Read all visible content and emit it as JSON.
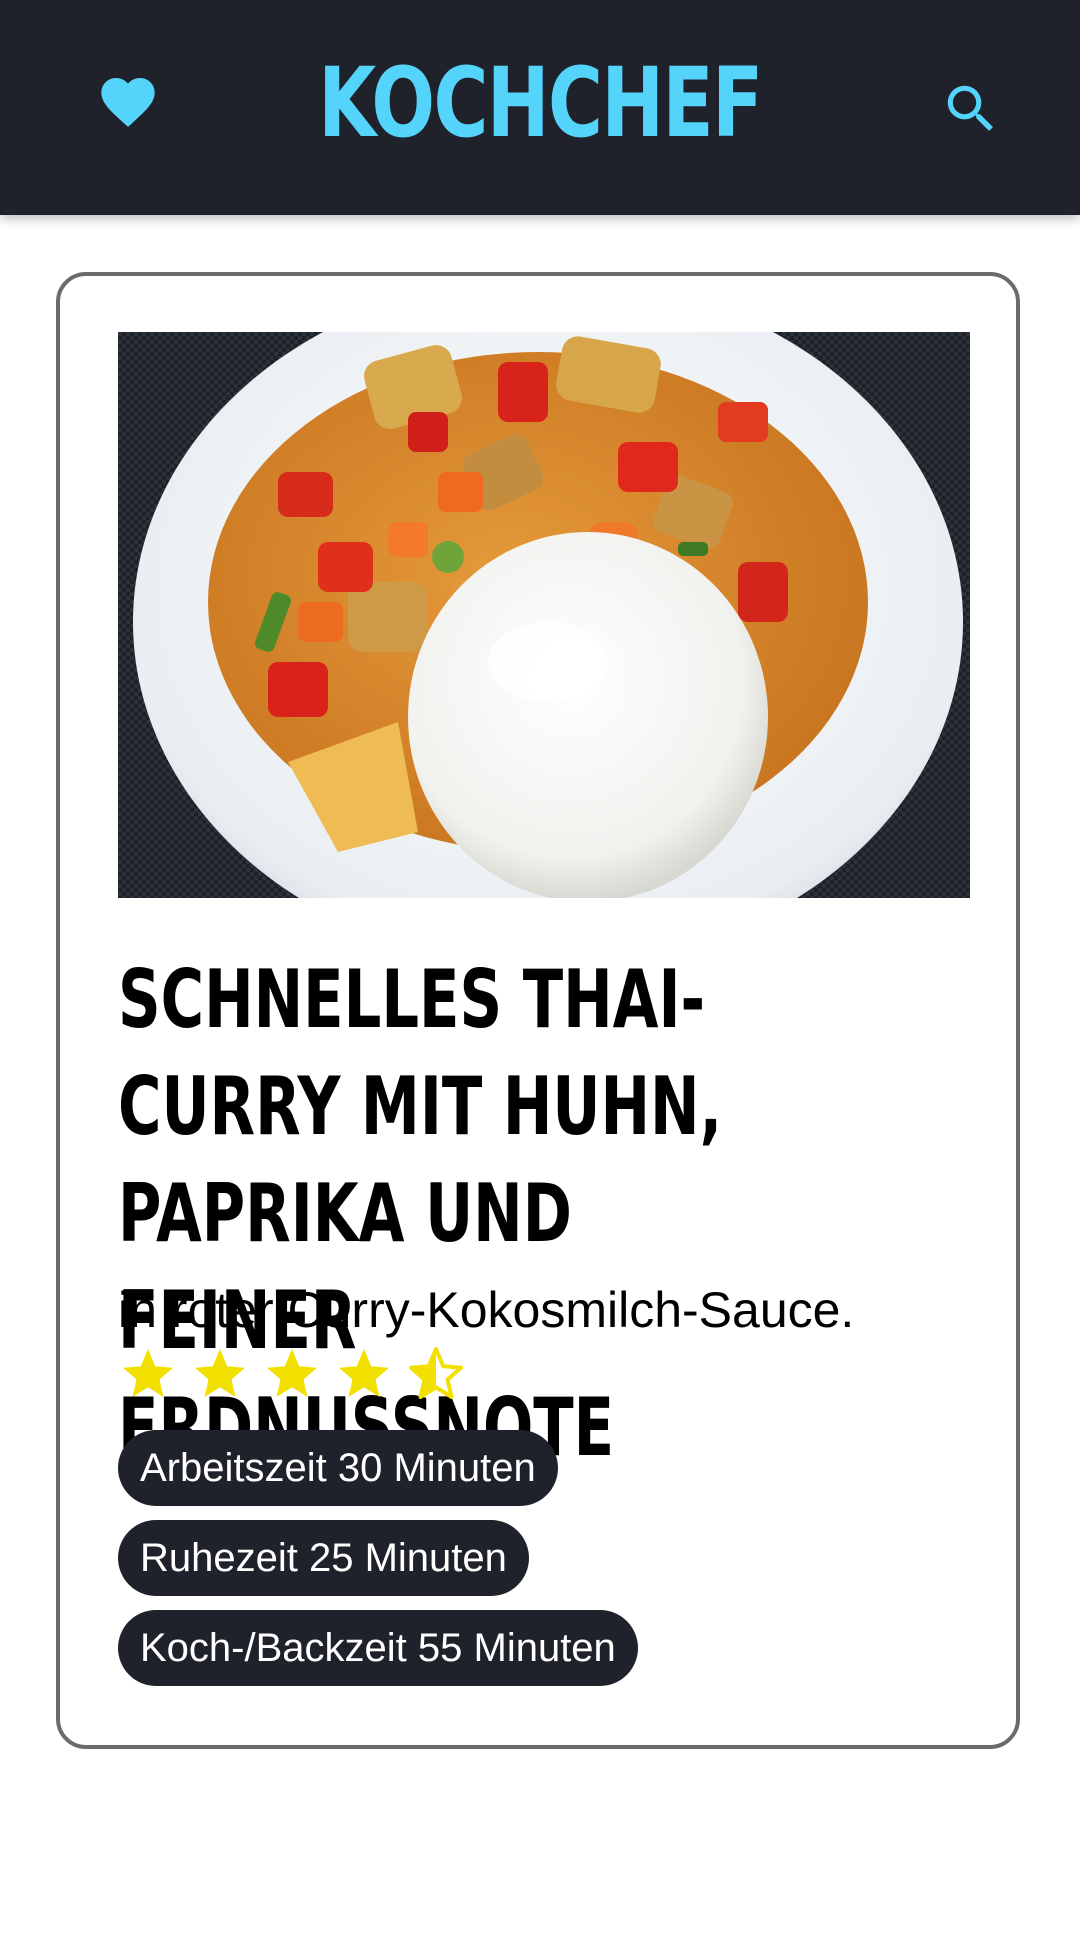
{
  "header": {
    "brand": "KOCHCHEF",
    "favorites_icon": "heart-icon",
    "search_icon": "search-icon",
    "accent_color": "#55d4fb",
    "background_color": "#1f222b"
  },
  "recipe": {
    "title": "Schnelles Thai-Curry mit Huhn, Paprika und feiner Erdnussnote",
    "subtitle": "in roter Curry-Kokosmilch-Sauce.",
    "rating": 4.5,
    "rating_max": 5,
    "star_color": "#f2e000",
    "tags": [
      {
        "label": "Arbeitszeit 30 Minuten"
      },
      {
        "label": "Ruhezeit 25 Minuten"
      },
      {
        "label": "Koch-/Backzeit 55 Minuten"
      }
    ]
  }
}
